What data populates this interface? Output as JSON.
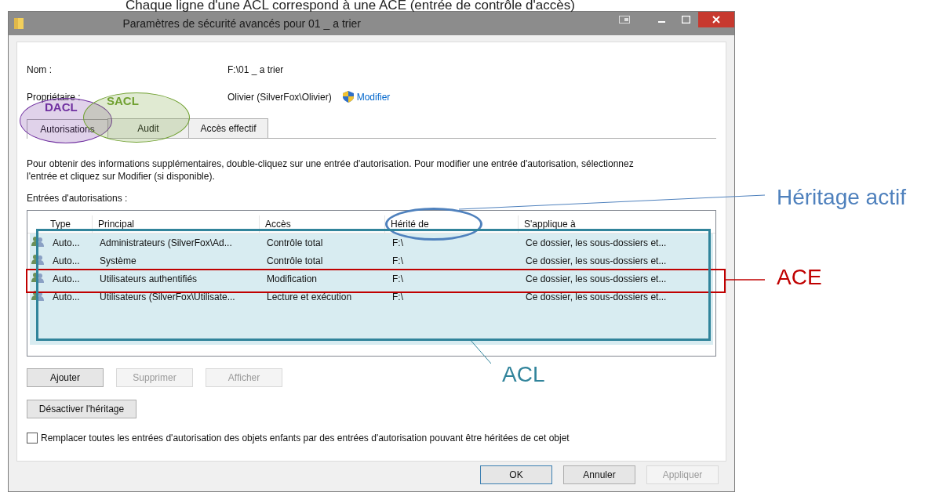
{
  "caption": "Chaque ligne d'une ACL correspond à une ACE (entrée de contrôle d'accès)",
  "window": {
    "title": "Paramètres de sécurité avancés pour 01 _ a trier"
  },
  "fields": [
    {
      "label": "Nom :",
      "value": "F:\\01 _ a trier"
    },
    {
      "label": "Propriétaire :",
      "value": "Olivier (SilverFox\\Olivier)",
      "link": "Modifier"
    }
  ],
  "tabs": [
    {
      "label": "Autorisations",
      "selected": true
    },
    {
      "label": "Audit",
      "selected": false
    },
    {
      "label": "Accès effectif",
      "selected": false
    }
  ],
  "description": "Pour obtenir des informations supplémentaires, double-cliquez sur une entrée d'autorisation. Pour modifier une entrée d'autorisation, sélectionnez l'entrée et cliquez sur Modifier (si disponible).",
  "list_label": "Entrées d'autorisations :",
  "table": {
    "columns": [
      "Type",
      "Principal",
      "Accès",
      "Hérité de",
      "S'applique à"
    ],
    "rows": [
      [
        "Auto...",
        "Administrateurs (SilverFox\\Ad...",
        "Contrôle total",
        "F:\\",
        "Ce dossier, les sous-dossiers et..."
      ],
      [
        "Auto...",
        "Système",
        "Contrôle total",
        "F:\\",
        "Ce dossier, les sous-dossiers et..."
      ],
      [
        "Auto...",
        "Utilisateurs authentifiés",
        "Modification",
        "F:\\",
        "Ce dossier, les sous-dossiers et..."
      ],
      [
        "Auto...",
        "Utilisateurs (SilverFox\\Utilisate...",
        "Lecture et exécution",
        "F:\\",
        "Ce dossier, les sous-dossiers et..."
      ]
    ]
  },
  "list_buttons": [
    {
      "label": "Ajouter",
      "disabled": false
    },
    {
      "label": "Supprimer",
      "disabled": true
    },
    {
      "label": "Afficher",
      "disabled": true
    }
  ],
  "inherit_button": "Désactiver l'héritage",
  "replace_checkbox": {
    "label": "Remplacer toutes les entrées d'autorisation des objets enfants par des entrées d'autorisation pouvant être héritées de cet objet",
    "checked": false
  },
  "footer_buttons": [
    {
      "label": "OK",
      "disabled": false,
      "default": true
    },
    {
      "label": "Annuler",
      "disabled": false,
      "default": false
    },
    {
      "label": "Appliquer",
      "disabled": true,
      "default": false
    }
  ],
  "annotations": [
    {
      "kind": "ellipse",
      "text": "DACL",
      "color": "#7030a0"
    },
    {
      "kind": "ellipse",
      "text": "SACL",
      "color": "#70a030"
    },
    {
      "kind": "callout",
      "text": "Héritage actif",
      "color": "#4f81bd"
    },
    {
      "kind": "row-box",
      "text": "ACE",
      "color": "#c00000"
    },
    {
      "kind": "list-box",
      "text": "ACL",
      "color": "#31849b"
    }
  ]
}
